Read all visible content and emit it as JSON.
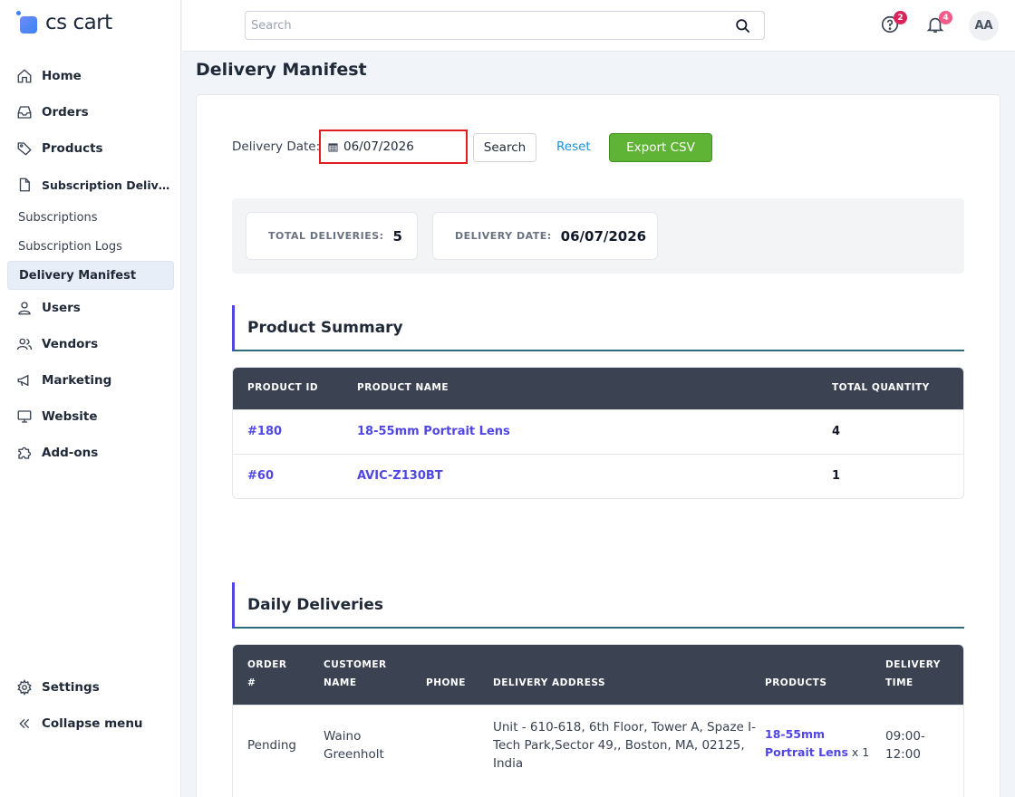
{
  "brand": {
    "name": "cs cart"
  },
  "sidebar": {
    "items": [
      {
        "label": "Home",
        "icon": "home-icon"
      },
      {
        "label": "Orders",
        "icon": "inbox-icon"
      },
      {
        "label": "Products",
        "icon": "tag-icon"
      },
      {
        "label": "Subscription Delivery Manifest",
        "icon": "document-icon"
      }
    ],
    "subitems": [
      {
        "label": "Subscriptions",
        "active": false
      },
      {
        "label": "Subscription Logs",
        "active": false
      },
      {
        "label": "Delivery Manifest",
        "active": true
      }
    ],
    "items2": [
      {
        "label": "Users",
        "icon": "user-icon"
      },
      {
        "label": "Vendors",
        "icon": "users-icon"
      },
      {
        "label": "Marketing",
        "icon": "megaphone-icon"
      },
      {
        "label": "Website",
        "icon": "monitor-icon"
      },
      {
        "label": "Add-ons",
        "icon": "puzzle-icon"
      }
    ],
    "bottom": [
      {
        "label": "Settings",
        "icon": "gear-icon"
      },
      {
        "label": "Collapse menu",
        "icon": "double-chevron-left-icon"
      }
    ]
  },
  "topbar": {
    "search_placeholder": "Search",
    "help_badge": "2",
    "notifications_badge": "4",
    "avatar_initials": "AA",
    "badge_colors": {
      "help": "#d6245a",
      "notifications": "#f25b8a"
    }
  },
  "page": {
    "title": "Delivery Manifest",
    "filter": {
      "label": "Delivery Date:",
      "date_value": "06/07/2026",
      "search_label": "Search",
      "reset_label": "Reset",
      "export_label": "Export CSV"
    },
    "stats": {
      "total_label": "TOTAL DELIVERIES:",
      "total_value": "5",
      "date_label": "DELIVERY DATE:",
      "date_value": "06/07/2026"
    },
    "product_summary": {
      "title": "Product Summary",
      "headers": [
        "PRODUCT ID",
        "PRODUCT NAME",
        "TOTAL QUANTITY"
      ],
      "rows": [
        {
          "id": "#180",
          "name": "18-55mm Portrait Lens",
          "qty": "4"
        },
        {
          "id": "#60",
          "name": "AVIC-Z130BT",
          "qty": "1"
        }
      ]
    },
    "daily_deliveries": {
      "title": "Daily Deliveries",
      "headers": {
        "order_1": "ORDER",
        "order_2": "#",
        "customer_1": "CUSTOMER",
        "customer_2": "NAME",
        "phone": "PHONE",
        "address": "DELIVERY ADDRESS",
        "products": "PRODUCTS",
        "time_1": "DELIVERY",
        "time_2": "TIME"
      },
      "rows": [
        {
          "order": "Pending",
          "customer_1": "Waino",
          "customer_2": "Greenholt",
          "phone": "",
          "address_1": "Unit - 610-618, 6th Floor, Tower A, Spaze I-",
          "address_2": "Tech Park,Sector 49,, Boston, MA, 02125,",
          "address_3": "India",
          "product_1": "18-55mm",
          "product_2": "Portrait Lens",
          "product_qty": "x 1",
          "time_1": "09:00-",
          "time_2": "12:00"
        }
      ]
    }
  }
}
